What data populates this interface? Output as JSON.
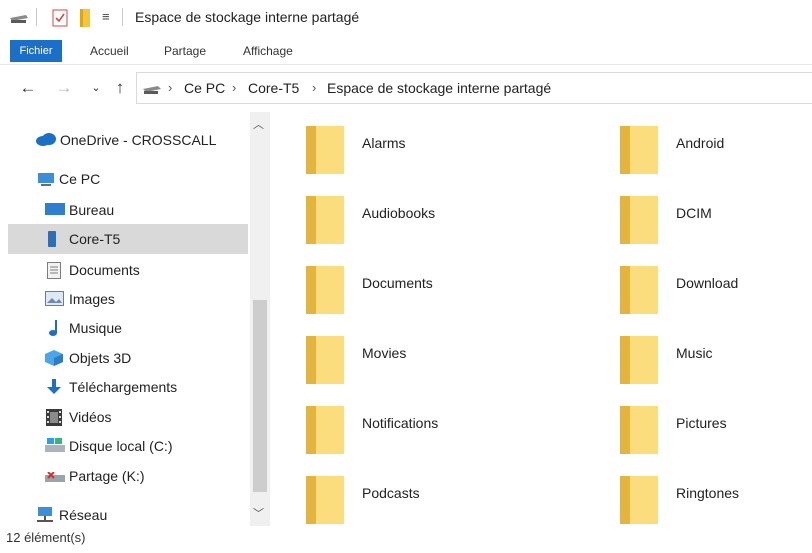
{
  "window": {
    "title": "Espace de stockage interne partagé"
  },
  "ribbon": {
    "tabs": [
      "Fichier",
      "Accueil",
      "Partage",
      "Affichage"
    ]
  },
  "address": {
    "crumbs": [
      "Ce PC",
      "Core-T5",
      "Espace de stockage interne partagé"
    ]
  },
  "sidebar": {
    "items": [
      {
        "label": "OneDrive - CROSSCALL",
        "icon": "onedrive-icon"
      },
      {
        "label": "Ce PC",
        "icon": "this-pc-icon"
      },
      {
        "label": "Bureau",
        "icon": "desktop-icon"
      },
      {
        "label": "Core-T5",
        "icon": "phone-icon",
        "selected": true
      },
      {
        "label": "Documents",
        "icon": "documents-icon"
      },
      {
        "label": "Images",
        "icon": "pictures-icon"
      },
      {
        "label": "Musique",
        "icon": "music-icon"
      },
      {
        "label": "Objets 3D",
        "icon": "3d-objects-icon"
      },
      {
        "label": "Téléchargements",
        "icon": "downloads-icon"
      },
      {
        "label": "Vidéos",
        "icon": "videos-icon"
      },
      {
        "label": "Disque local (C:)",
        "icon": "local-disk-icon"
      },
      {
        "label": "Partage (K:)",
        "icon": "network-drive-icon"
      },
      {
        "label": "Réseau",
        "icon": "network-icon"
      }
    ]
  },
  "folders": [
    "Alarms",
    "Android",
    "Audiobooks",
    "DCIM",
    "Documents",
    "Download",
    "Movies",
    "Music",
    "Notifications",
    "Pictures",
    "Podcasts",
    "Ringtones"
  ],
  "status": {
    "count": "12 élément(s)"
  },
  "colors": {
    "accent": "#1a6fc9",
    "folder": "#f7d46a",
    "selection": "#d9d9d9"
  }
}
